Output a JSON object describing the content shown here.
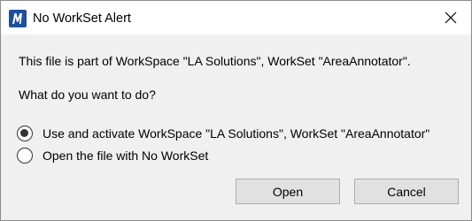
{
  "window": {
    "title": "No WorkSet Alert",
    "icon": "microstation-app-icon",
    "close_icon": "close-icon"
  },
  "dialog": {
    "message": "This file is part of WorkSpace \"LA Solutions\", WorkSet \"AreaAnnotator\".",
    "question": "What do you want to do?",
    "options": [
      {
        "label": "Use and activate WorkSpace \"LA Solutions\", WorkSet \"AreaAnnotator\"",
        "selected": true
      },
      {
        "label": "Open the file with No WorkSet",
        "selected": false
      }
    ],
    "buttons": {
      "open_label": "Open",
      "cancel_label": "Cancel"
    }
  },
  "colors": {
    "content_bg": "#f0f0f0",
    "title_bg": "#ffffff",
    "button_bg": "#e1e1e1",
    "icon_blue": "#1f4e9c"
  }
}
